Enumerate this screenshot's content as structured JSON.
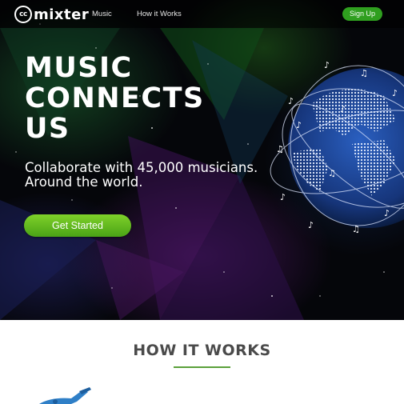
{
  "nav": {
    "logo_cc": "cc",
    "logo_word": "mixter",
    "links": [
      "Music",
      "How it Works"
    ],
    "signup_label": "Sign Up"
  },
  "hero": {
    "headline_lines": [
      "MUSIC",
      "CONNECTS",
      "US"
    ],
    "subhead_lines": [
      "Collaborate with 45,000 musicians.",
      "Around the world."
    ],
    "cta_label": "Get Started"
  },
  "how_it_works": {
    "title": "HOW IT WORKS"
  },
  "colors": {
    "accent_green": "#2f9f1f",
    "cta_green": "#6cc024",
    "hero_bg": "#05060a",
    "globe_blue": "#1b3f8f"
  },
  "icons": [
    "music-note-icon",
    "globe-icon",
    "instrument-icon"
  ]
}
